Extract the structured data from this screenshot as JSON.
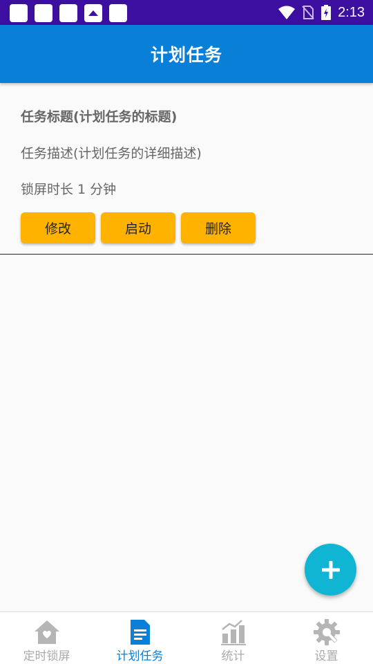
{
  "status_bar": {
    "time": "2:13",
    "icons": [
      "app-notification-icon",
      "app-notification-icon",
      "app-notification-icon",
      "image-notification-icon",
      "app-notification-icon",
      "wifi-icon",
      "no-sim-icon",
      "battery-charging-icon"
    ]
  },
  "app_bar": {
    "title": "计划任务"
  },
  "task": {
    "title": "任务标题(计划任务的标题)",
    "description": "任务描述(计划任务的详细描述)",
    "lock_duration": "锁屏时长 1 分钟",
    "buttons": {
      "edit": "修改",
      "start": "启动",
      "delete": "删除"
    }
  },
  "fab": {
    "icon": "plus-icon"
  },
  "bottom_nav": {
    "items": [
      {
        "label": "定时锁屏",
        "icon": "home-icon",
        "active": false
      },
      {
        "label": "计划任务",
        "icon": "document-icon",
        "active": true
      },
      {
        "label": "统计",
        "icon": "bar-chart-icon",
        "active": false
      },
      {
        "label": "设置",
        "icon": "gear-icon",
        "active": false
      }
    ]
  },
  "colors": {
    "status_bar": "#3d0fa0",
    "app_bar": "#0a7fd8",
    "button": "#ffb300",
    "fab": "#10b5d4",
    "nav_active": "#0a7fd8",
    "nav_inactive": "#aaaaaa"
  }
}
